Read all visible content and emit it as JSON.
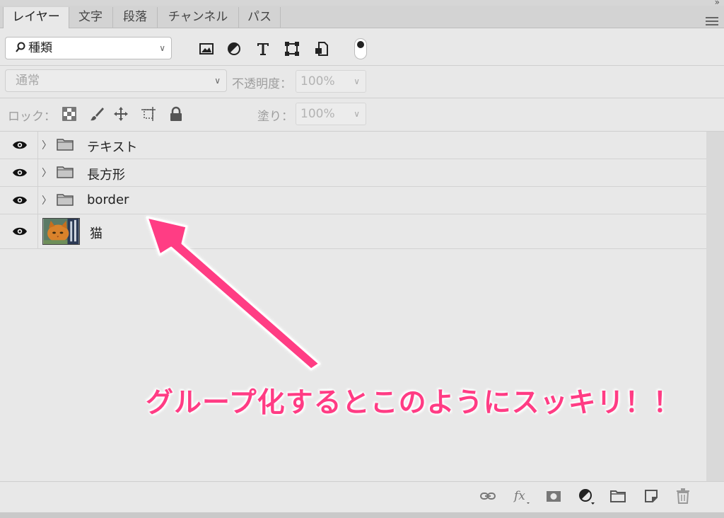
{
  "tabs": [
    {
      "label": "レイヤー",
      "active": true
    },
    {
      "label": "文字",
      "active": false
    },
    {
      "label": "段落",
      "active": false
    },
    {
      "label": "チャンネル",
      "active": false
    },
    {
      "label": "パス",
      "active": false
    }
  ],
  "filter": {
    "kind_label": "種類",
    "icons": [
      "image-filter-icon",
      "adjustment-filter-icon",
      "type-filter-icon",
      "shape-filter-icon",
      "smart-object-filter-icon"
    ]
  },
  "blend": {
    "mode": "通常",
    "opacity_label": "不透明度：",
    "opacity_value": "100%"
  },
  "lock": {
    "label": "ロック：",
    "fill_label": "塗り：",
    "fill_value": "100%"
  },
  "layers": [
    {
      "name": "テキスト",
      "type": "group"
    },
    {
      "name": "長方形",
      "type": "group"
    },
    {
      "name": "border",
      "type": "group"
    },
    {
      "name": "猫",
      "type": "image"
    }
  ],
  "annotation": {
    "text": "グループ化するとこのようにスッキリ！！",
    "color": "#ff3c84"
  },
  "bottom_icons": [
    "link-icon",
    "fx-icon",
    "mask-icon",
    "adjustment-icon",
    "new-group-icon",
    "new-layer-icon",
    "trash-icon"
  ]
}
